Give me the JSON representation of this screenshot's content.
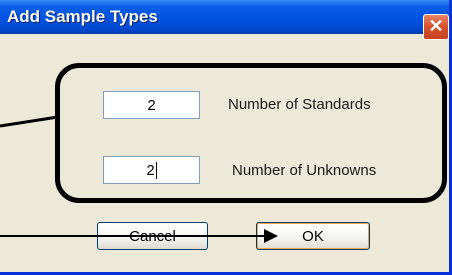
{
  "window": {
    "title": "Add Sample Types",
    "close_glyph": "✕"
  },
  "fields": {
    "standards": {
      "value": "2",
      "label": "Number of Standards"
    },
    "unknowns": {
      "value": "2",
      "label": "Number of Unknowns"
    }
  },
  "buttons": {
    "cancel": "Cancel",
    "ok": "OK"
  },
  "icons": [
    "close-icon"
  ],
  "colors": {
    "titlebar": "#0054e3",
    "dialog_bg": "#ece9d8",
    "close_button": "#d8552f",
    "annotation": "#000000"
  }
}
